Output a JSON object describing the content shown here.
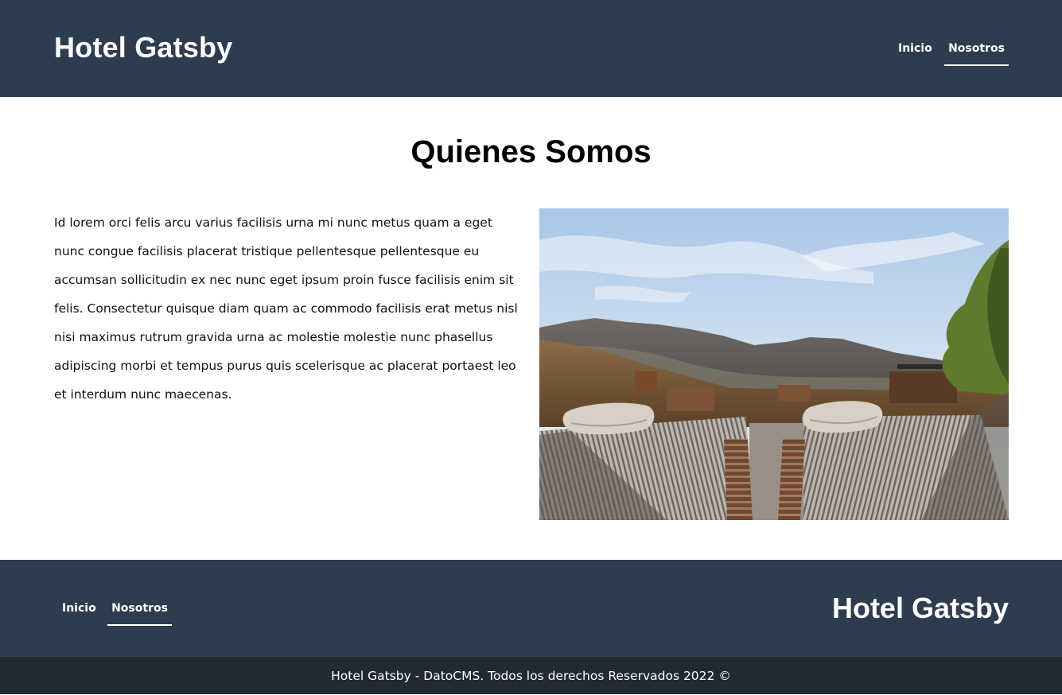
{
  "header": {
    "brand": "Hotel Gatsby",
    "nav": [
      {
        "label": "Inicio"
      },
      {
        "label": "Nosotros"
      }
    ]
  },
  "main": {
    "title": "Quienes Somos",
    "paragraph": "Id lorem orci felis arcu varius facilisis urna mi nunc metus quam a eget nunc congue facilisis placerat tristique pellentesque pellentesque eu accumsan sollicitudin ex nec nunc eget ipsum proin fusce facilisis enim sit felis. Consectetur quisque diam quam ac commodo facilisis erat metus nisl nisi maximus rutrum gravida urna ac molestie molestie nunc phasellus adipiscing morbi et tempus purus quis scelerisque ac placerat portaest leo et interdum nunc maecenas."
  },
  "footer": {
    "nav": [
      {
        "label": "Inicio"
      },
      {
        "label": "Nosotros"
      }
    ],
    "brand": "Hotel Gatsby",
    "copyright": "Hotel Gatsby - DatoCMS. Todos los derechos Reservados 2022 ©"
  },
  "colors": {
    "header_bg": "#2d3c4f",
    "copyright_bg": "#212a33"
  }
}
